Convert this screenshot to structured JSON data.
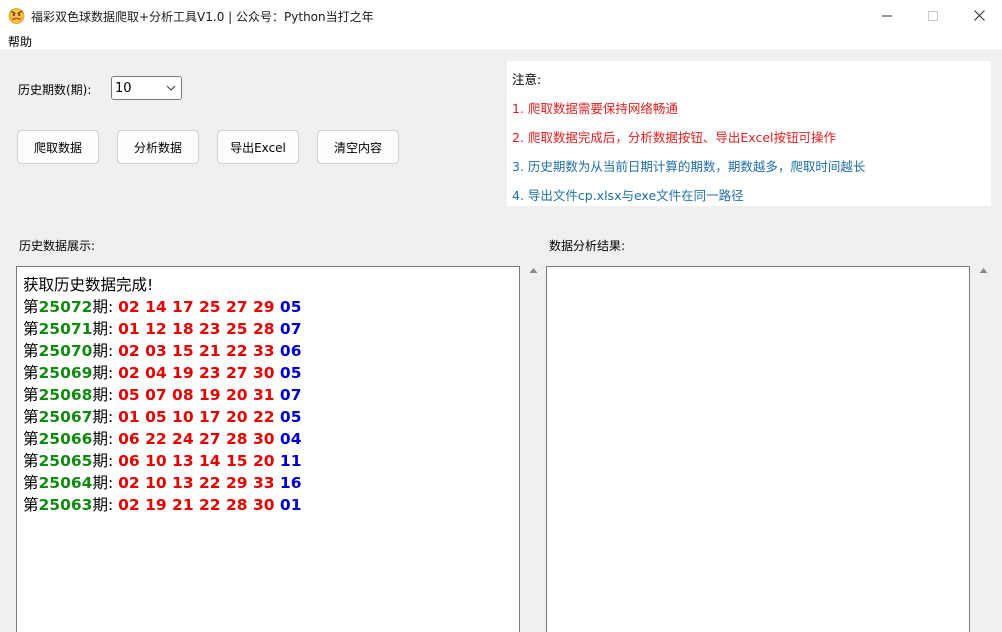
{
  "window": {
    "title": "福彩双色球数据爬取+分析工具V1.0 | 公众号：Python当打之年",
    "icon": "angry-emoji-icon"
  },
  "menu": {
    "help": "帮助"
  },
  "controls": {
    "period_label": "历史期数(期):",
    "period_value": "10",
    "buttons": {
      "crawl": "爬取数据",
      "analyze": "分析数据",
      "export": "导出Excel",
      "clear": "清空内容"
    }
  },
  "notice": {
    "title": "注意:",
    "lines": [
      {
        "text": "1. 爬取数据需要保持网络畅通",
        "color": "#e02020"
      },
      {
        "text": "2. 爬取数据完成后，分析数据按钮、导出Excel按钮可操作",
        "color": "#e02020"
      },
      {
        "text": "3. 历史期数为从当前日期计算的期数，期数越多，爬取时间越长",
        "color": "#1f6fa8"
      },
      {
        "text": "4. 导出文件cp.xlsx与exe文件在同一路径",
        "color": "#1f6fa8"
      }
    ]
  },
  "history": {
    "label": "历史数据展示:",
    "status": "获取历史数据完成!",
    "prefix": "第",
    "suffix": "期: ",
    "rows": [
      {
        "issue": "25072",
        "reds": "02 14 17 25 27 29",
        "blue": "05"
      },
      {
        "issue": "25071",
        "reds": "01 12 18 23 25 28",
        "blue": "07"
      },
      {
        "issue": "25070",
        "reds": "02 03 15 21 22 33",
        "blue": "06"
      },
      {
        "issue": "25069",
        "reds": "02 04 19 23 27 30",
        "blue": "05"
      },
      {
        "issue": "25068",
        "reds": "05 07 08 19 20 31",
        "blue": "07"
      },
      {
        "issue": "25067",
        "reds": "01 05 10 17 20 22",
        "blue": "05"
      },
      {
        "issue": "25066",
        "reds": "06 22 24 27 28 30",
        "blue": "04"
      },
      {
        "issue": "25065",
        "reds": "06 10 13 14 15 20",
        "blue": "11"
      },
      {
        "issue": "25064",
        "reds": "02 10 13 22 29 33",
        "blue": "16"
      },
      {
        "issue": "25063",
        "reds": "02 19 21 22 28 30",
        "blue": "01"
      }
    ]
  },
  "analysis": {
    "label": "数据分析结果:"
  },
  "colors": {
    "issue_green": "#118a11",
    "red_ball": "#e60000",
    "blue_ball": "#0000cc"
  }
}
